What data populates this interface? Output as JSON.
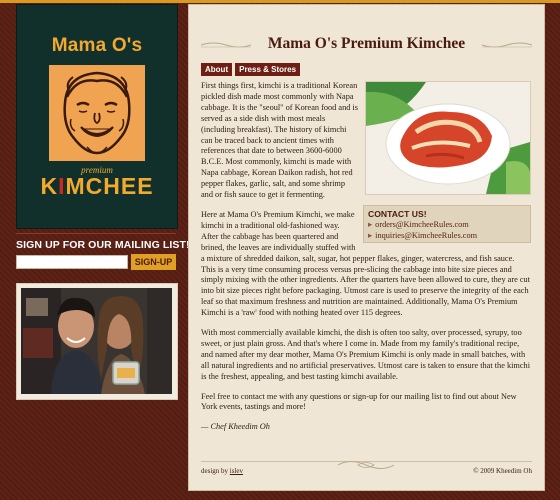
{
  "logo": {
    "title": "Mama O's",
    "premium": "premium",
    "kimchee_start": "K",
    "kimchee_i": "I",
    "kimchee_end": "MCHEE"
  },
  "signup": {
    "title": "SIGN UP FOR OUR MAILING LIST!",
    "input_value": "",
    "button_label": "SIGN-UP"
  },
  "main": {
    "title": "Mama O's Premium Kimchee",
    "nav": [
      {
        "label": "About"
      },
      {
        "label": "Press & Stores"
      }
    ],
    "contact": {
      "title": "CONTACT US!",
      "emails": [
        "orders@KimcheeRules.com",
        "inquiries@KimcheeRules.com"
      ]
    },
    "paragraphs": [
      "First things first, kimchi is a traditional Korean pickled dish made most commonly with Napa cabbage. It is the \"seoul\" of Korean food and is served as a side dish with most meals (including breakfast). The history of kimchi can be traced back to ancient times with references that date to between 3600-6000 B.C.E. Most commonly, kimchi is made with Napa cabbage, Korean Daikon radish, hot red pepper flakes, garlic, salt, and some shrimp and or fish sauce to get it fermenting.",
      "Here at Mama O's Premium Kimchi, we make kimchi in a traditional old-fashioned way. After the cabbage has been quartered and brined, the leaves are individually stuffed with a mixture of shredded daikon, salt, sugar, hot pepper flakes, ginger, watercress, and fish sauce. This is a very time consuming process versus pre-slicing the cabbage into bite size pieces and simply mixing with the other ingredients. After the quarters have been allowed to cure, they are cut into bit size pieces right before packaging. Utmost care is used to preserve the integrity of the each leaf so that maximum freshness and nutrition are maintained. Additionally, Mama O's Premium Kimchi is a 'raw' food with nothing heated over 115 degrees.",
      "With most commercially available kimchi, the dish is often too salty, over processed, syrupy, too sweet, or just plain gross. And that's where I come in. Made from my family's traditional recipe, and named after my dear mother, Mama O's Premium Kimchi is only made in small batches, with all natural ingredients and no artificial preservatives. Utmost care is taken to ensure that the kimchi is the freshest, appealing, and best tasting kimchi available.",
      "Feel free to contact me with any questions or sign-up for our mailing list to find out about New York events, tastings and more!"
    ],
    "signature": "— Chef Kheedim Oh"
  },
  "footer": {
    "design_by": "design by",
    "designer": "islev",
    "copyright": "© 2009 Kheedim Oh"
  },
  "colors": {
    "background": "#5a1f13",
    "accent": "#f2a92e",
    "panel": "#efe6d6",
    "nav_button": "#6e1f14",
    "title_text": "#4a1c10"
  }
}
